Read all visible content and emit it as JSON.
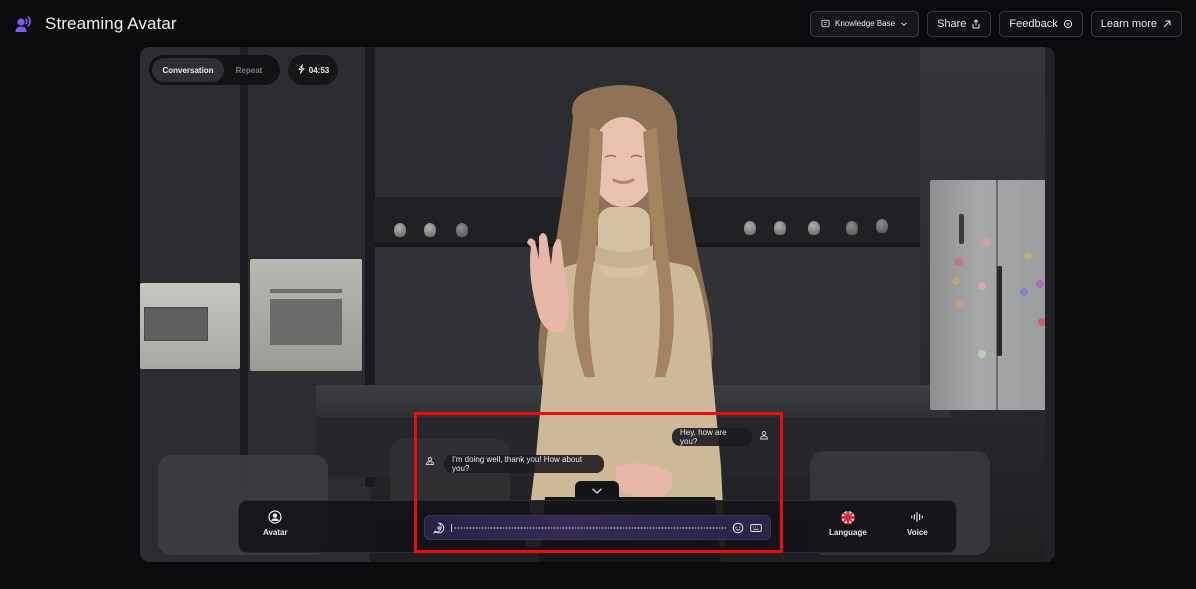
{
  "app": {
    "title": "Streaming Avatar",
    "brand_color": "#7c5cf0"
  },
  "header": {
    "buttons": [
      {
        "label": "Knowledge Base",
        "icon": "book-icon",
        "trailing_icon": "chevron-down-icon"
      },
      {
        "label": "Share",
        "icon": "share-icon"
      },
      {
        "label": "Feedback",
        "icon": "chat-bubble-icon"
      },
      {
        "label": "Learn more",
        "icon": "arrow-up-right-icon"
      }
    ]
  },
  "stage": {
    "mode_tabs": [
      {
        "label": "Conversation",
        "active": true
      },
      {
        "label": "Repeat",
        "active": false
      }
    ],
    "timer": {
      "icon": "lightning-icon",
      "value": "04:53"
    },
    "chat": {
      "messages": [
        {
          "role": "user",
          "text": "Hey, how are you?",
          "icon": "user-icon"
        },
        {
          "role": "avatar",
          "text": "I'm doing well, thank you! How about you?",
          "icon": "avatar-bot-icon"
        }
      ],
      "collapse_icon": "chevron-down-icon"
    },
    "controls": {
      "avatar": {
        "label": "Avatar",
        "icon": "user-circle-icon"
      },
      "language": {
        "label": "Language",
        "icon": "uk-flag-icon"
      },
      "voice": {
        "label": "Voice",
        "icon": "waveform-icon"
      },
      "input": {
        "left_icon": "add-message-icon",
        "right_icons": [
          "emoji-icon",
          "keyboard-icon"
        ],
        "accent": "#342a55"
      }
    }
  },
  "annotation": {
    "highlight_color": "#f20a0a"
  }
}
